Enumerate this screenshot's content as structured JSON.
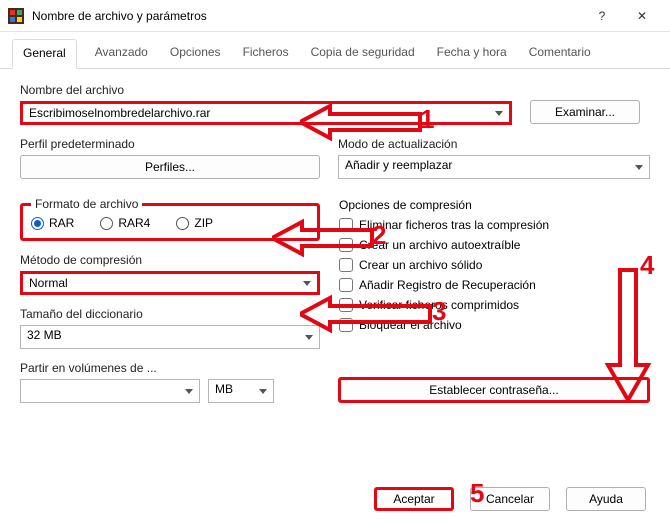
{
  "window": {
    "title": "Nombre de archivo y parámetros",
    "help_symbol": "?",
    "close_symbol": "✕"
  },
  "tabs": {
    "items": [
      {
        "label": "General",
        "active": true
      },
      {
        "label": "Avanzado"
      },
      {
        "label": "Opciones"
      },
      {
        "label": "Ficheros"
      },
      {
        "label": "Copia de seguridad"
      },
      {
        "label": "Fecha y hora"
      },
      {
        "label": "Comentario"
      }
    ]
  },
  "filename": {
    "label": "Nombre del archivo",
    "value": "Escribimoselnombredelarchivo.rar",
    "browse": "Examinar..."
  },
  "profile": {
    "label": "Perfil predeterminado",
    "button": "Perfiles..."
  },
  "update_mode": {
    "label": "Modo de actualización",
    "value": "Añadir y reemplazar"
  },
  "format": {
    "label": "Formato de archivo",
    "options": [
      "RAR",
      "RAR4",
      "ZIP"
    ],
    "selected": "RAR"
  },
  "method": {
    "label": "Método de compresión",
    "value": "Normal"
  },
  "dict": {
    "label": "Tamaño del diccionario",
    "value": "32 MB"
  },
  "volumes": {
    "label": "Partir en volúmenes de ...",
    "value": "",
    "unit": "MB"
  },
  "comp_options": {
    "label": "Opciones de compresión",
    "items": [
      "Eliminar ficheros tras la compresión",
      "Crear un archivo autoextraíble",
      "Crear un archivo sólido",
      "Añadir Registro de Recuperación",
      "Verificar ficheros comprimidos",
      "Bloquear el archivo"
    ]
  },
  "password_btn": "Establecer contraseña...",
  "footer": {
    "ok": "Aceptar",
    "cancel": "Cancelar",
    "help": "Ayuda"
  },
  "annotations": {
    "n1": "1",
    "n2": "2",
    "n3": "3",
    "n4": "4",
    "n5": "5"
  }
}
